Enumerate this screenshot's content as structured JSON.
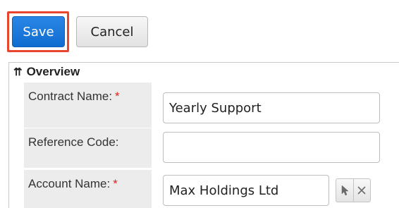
{
  "toolbar": {
    "save_label": "Save",
    "cancel_label": "Cancel"
  },
  "panel": {
    "title": "Overview",
    "chevron_icon": "double-chevron-up"
  },
  "form": {
    "contract_name": {
      "label": "Contract Name:",
      "required": "*",
      "value": "Yearly Support"
    },
    "reference_code": {
      "label": "Reference Code:",
      "value": ""
    },
    "account_name": {
      "label": "Account Name:",
      "required": "*",
      "value": "Max Holdings Ltd"
    }
  },
  "account_actions": {
    "select_icon": "cursor-arrow-icon",
    "clear_icon": "clear-x-icon"
  },
  "colors": {
    "primary": "#1272d8",
    "highlight": "#e8442e",
    "required": "#dd2222"
  }
}
